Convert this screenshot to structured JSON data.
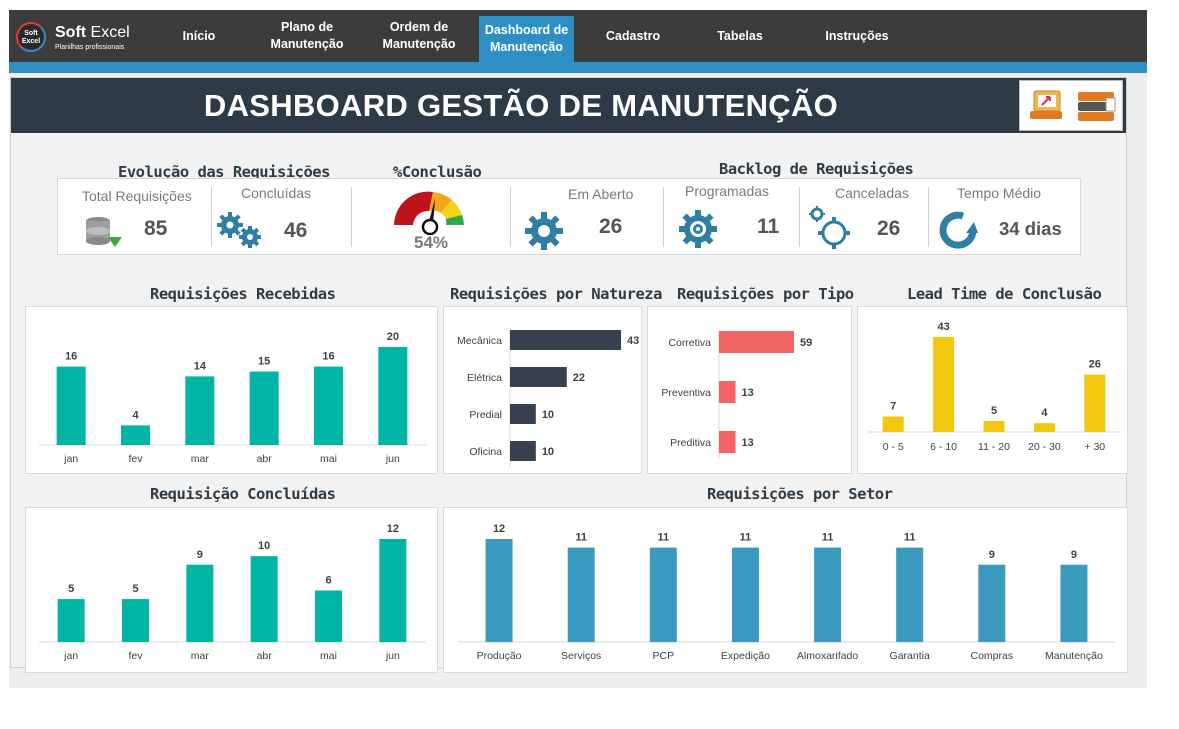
{
  "brand": {
    "title": "Soft",
    "title_light": " Excel",
    "subtitle": "Planilhas profissionais",
    "mark": "Soft\nExcel"
  },
  "nav": {
    "items": [
      {
        "label": "Início"
      },
      {
        "label": "Plano de\nManutenção"
      },
      {
        "label": "Ordem de\nManutenção"
      },
      {
        "label": "Dashboard de\nManutenção",
        "active": true
      },
      {
        "label": "Cadastro"
      },
      {
        "label": "Tabelas"
      },
      {
        "label": "Instruções"
      }
    ]
  },
  "header": {
    "title": "DASHBOARD GESTÃO DE MANUTENÇÃO"
  },
  "sections": {
    "evolucao": "Evolução das Requisições",
    "conclusao": "%Conclusão",
    "backlog": "Backlog de Requisições",
    "recebidas": "Requisições Recebidas",
    "natureza": "Requisições por Natureza",
    "tipo": "Requisições por Tipo",
    "leadtime": "Lead Time de Conclusão",
    "concluidas": "Requisição Concluídas",
    "setor": "Requisições por Setor"
  },
  "kpis": {
    "total_label": "Total Requisições",
    "total_value": "85",
    "concluidas_label": "Concluídas",
    "concluidas_value": "46",
    "gauge_value": "54%",
    "aberto_label": "Em Aberto",
    "aberto_value": "26",
    "programadas_label": "Programadas",
    "programadas_value": "11",
    "canceladas_label": "Canceladas",
    "canceladas_value": "26",
    "tempo_label": "Tempo Médio",
    "tempo_value": "34 dias"
  },
  "colors": {
    "teal": "#00b5a5",
    "navy": "#37414f",
    "red": "#f26464",
    "yellow": "#f2c80f",
    "blue": "#3a9bbe",
    "accent": "#2e8fc5"
  },
  "chart_data": [
    {
      "id": "recebidas",
      "type": "bar",
      "categories": [
        "jan",
        "fev",
        "mar",
        "abr",
        "mai",
        "jun"
      ],
      "values": [
        16,
        4,
        14,
        15,
        16,
        20
      ]
    },
    {
      "id": "natureza",
      "type": "bar",
      "orientation": "horizontal",
      "categories": [
        "Mecânica",
        "Elétrica",
        "Predial",
        "Oficina"
      ],
      "values": [
        43,
        22,
        10,
        10
      ]
    },
    {
      "id": "tipo",
      "type": "bar",
      "orientation": "horizontal",
      "categories": [
        "Corretiva",
        "Preventiva",
        "Preditiva"
      ],
      "values": [
        59,
        13,
        13
      ]
    },
    {
      "id": "leadtime",
      "type": "bar",
      "categories": [
        "0 - 5",
        "6 - 10",
        "11 - 20",
        "20 - 30",
        "+ 30"
      ],
      "values": [
        7,
        43,
        5,
        4,
        26
      ]
    },
    {
      "id": "concluidas",
      "type": "bar",
      "categories": [
        "jan",
        "fev",
        "mar",
        "abr",
        "mai",
        "jun"
      ],
      "values": [
        5,
        5,
        9,
        10,
        6,
        12
      ]
    },
    {
      "id": "setor",
      "type": "bar",
      "categories": [
        "Produção",
        "Serviços",
        "PCP",
        "Expedição",
        "Almoxarifado",
        "Garantia",
        "Compras",
        "Manutenção"
      ],
      "values": [
        12,
        11,
        11,
        11,
        11,
        11,
        9,
        9
      ]
    }
  ]
}
